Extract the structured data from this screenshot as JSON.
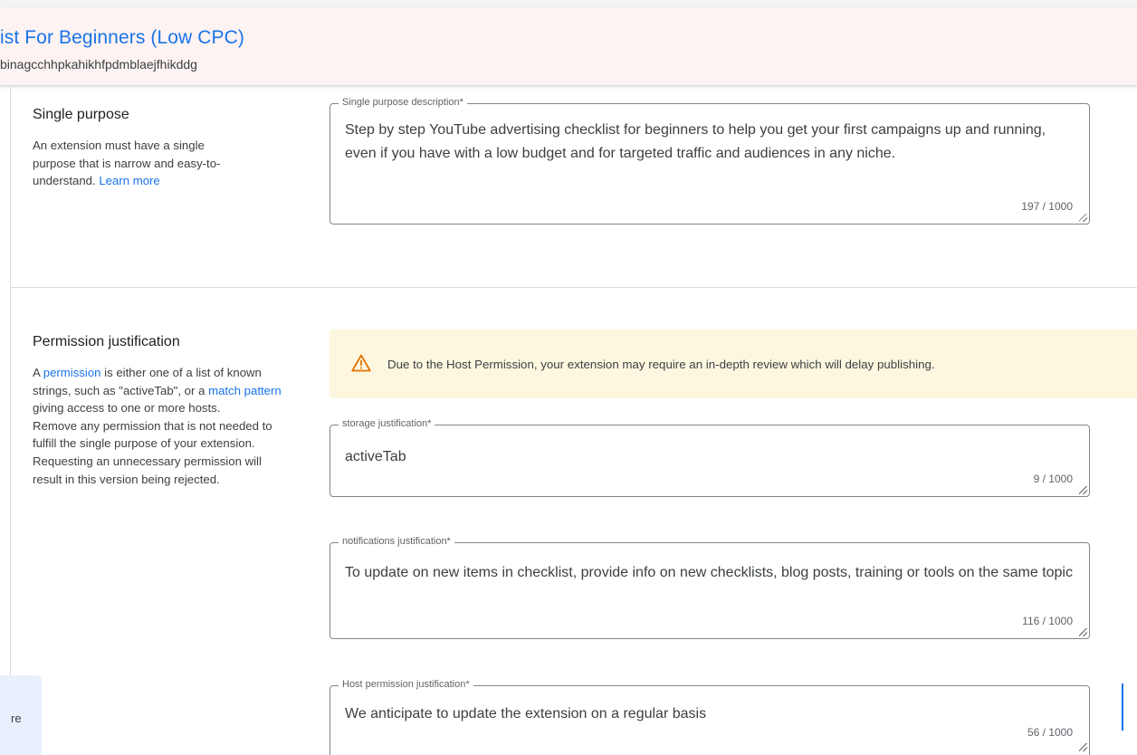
{
  "header": {
    "title": "ist For Beginners (Low CPC)",
    "item_id": "binagcchhpkahikhfpdmblaejfhikddg"
  },
  "single_purpose": {
    "title": "Single purpose",
    "description_lines": [
      "An extension must have a single",
      "purpose that is narrow and easy-to-"
    ],
    "description_tail": "understand. ",
    "learn_more": "Learn more",
    "field": {
      "label": "Single purpose description*",
      "value": "Step by step YouTube advertising checklist for beginners to help you get your first campaigns up and running, even if you have with a low budget and for targeted traffic and audiences in any niche.",
      "counter": "197 / 1000"
    }
  },
  "permission": {
    "title": "Permission justification",
    "desc": {
      "p1_a": "A ",
      "p1_link": "permission",
      "p1_b": " is either one of a list of known strings, such as \"activeTab\", or a ",
      "p1_link2": "match pattern",
      "p1_c": " giving access to one or more hosts.",
      "p2": "Remove any permission that is not needed to fulfill the single purpose of your extension. Requesting an unnecessary permission will result in this version being rejected."
    },
    "warning": {
      "icon": "warning-triangle-icon",
      "text": "Due to the Host Permission, your extension may require an in-depth review which will delay publishing.",
      "color": "#f9ab00"
    },
    "fields": [
      {
        "label": "storage justification*",
        "value": "activeTab",
        "counter": "9 / 1000"
      },
      {
        "label": "notifications justification*",
        "value": "To update on new items in checklist, provide info on new checklists, blog posts, training or tools on the same topic",
        "counter": "116 / 1000"
      },
      {
        "label": "Host permission justification*",
        "value": "We anticipate to update the extension on a regular basis",
        "counter": "56 / 1000"
      }
    ]
  },
  "side_card": {
    "text": "re"
  },
  "colors": {
    "accent": "#1a73e8",
    "header_bg": "#fdf3f2",
    "warning_bg": "#fef7e0"
  }
}
